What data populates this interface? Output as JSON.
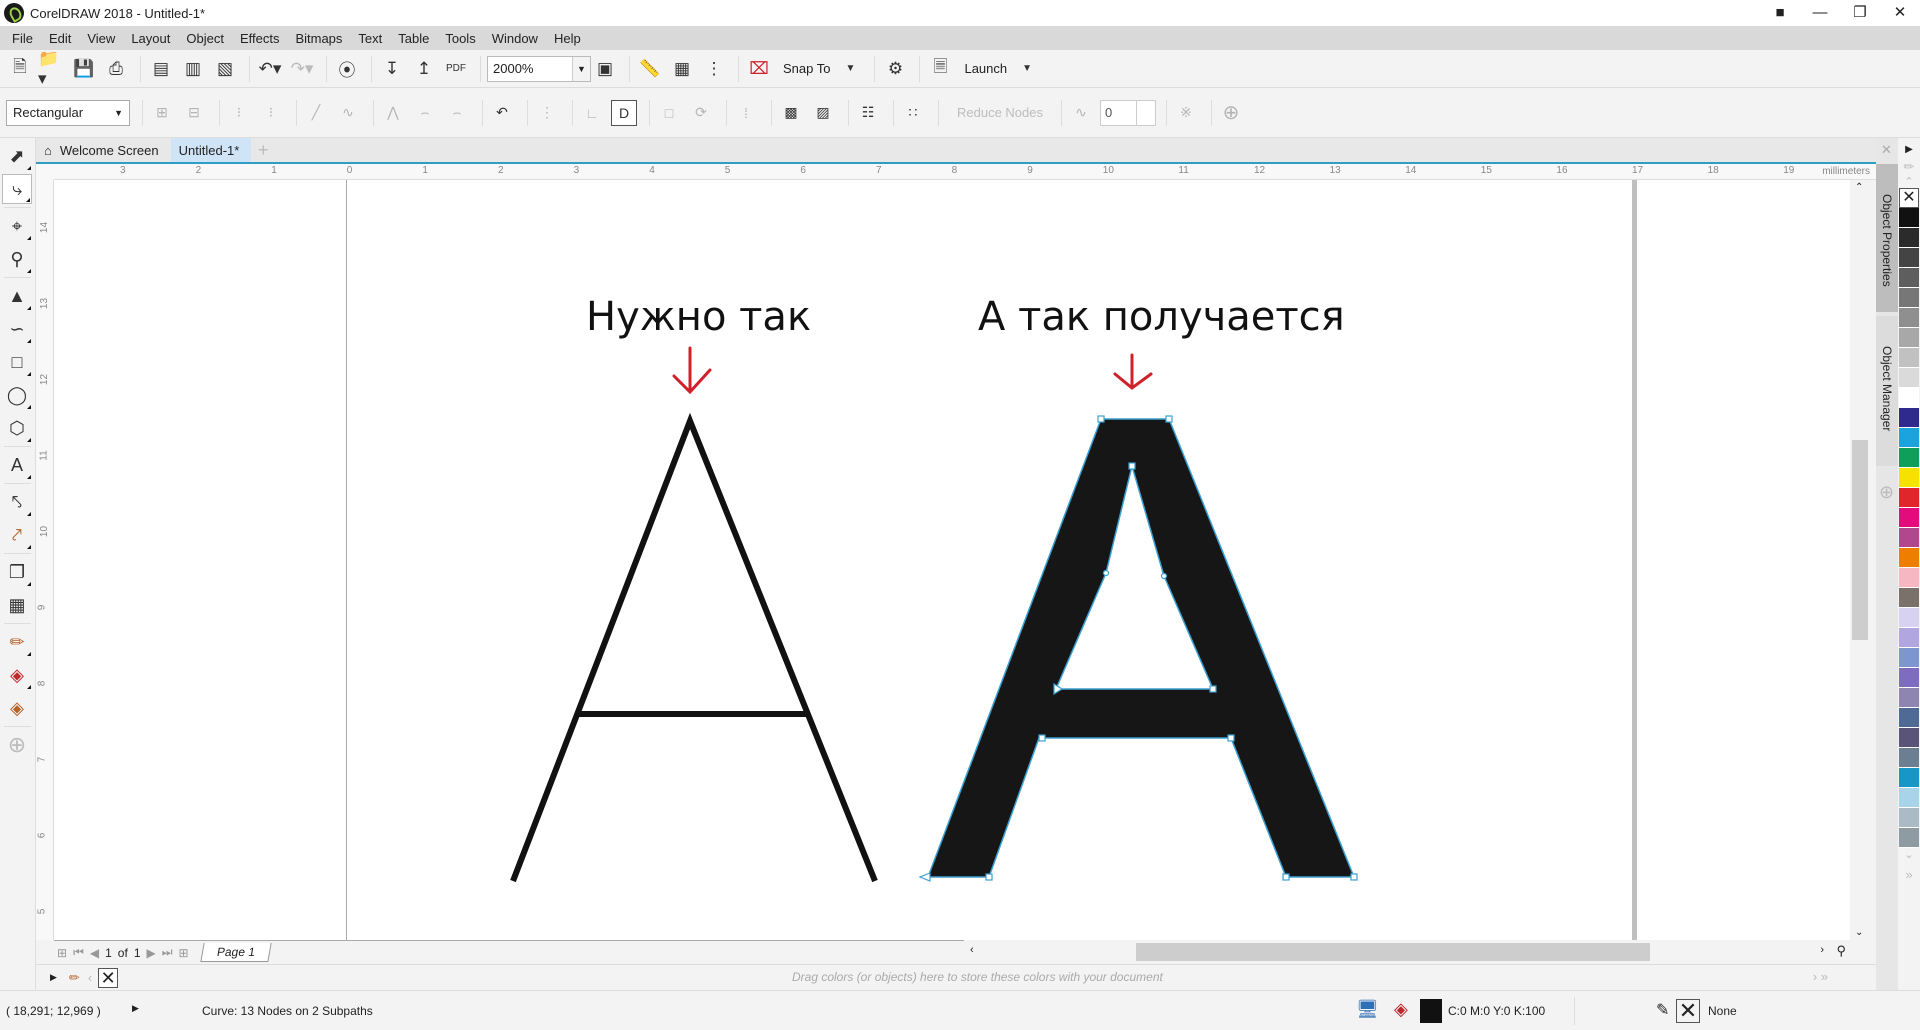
{
  "window": {
    "title": "CorelDRAW 2018 - Untitled-1*"
  },
  "menu": [
    "File",
    "Edit",
    "View",
    "Layout",
    "Object",
    "Effects",
    "Bitmaps",
    "Text",
    "Table",
    "Tools",
    "Window",
    "Help"
  ],
  "toolbar": {
    "zoom_level": "2000%",
    "snap_to_label": "Snap To",
    "launch_label": "Launch",
    "pdf_label": "PDF"
  },
  "property_bar": {
    "selection_mode": "Rectangular",
    "reduce_nodes_label": "Reduce Nodes",
    "curve_smoothness": "0"
  },
  "tabs": [
    {
      "label": "Welcome Screen"
    },
    {
      "label": "Untitled-1*"
    }
  ],
  "rulers": {
    "unit": "millimeters",
    "horizontal": [
      "3",
      "2",
      "1",
      "0",
      "1",
      "2",
      "3",
      "4",
      "5",
      "6",
      "7",
      "8",
      "9",
      "10",
      "11",
      "12",
      "13",
      "14",
      "15",
      "16",
      "17",
      "18",
      "19"
    ],
    "vertical": [
      "14",
      "13",
      "12",
      "11",
      "10",
      "9",
      "8",
      "7",
      "6",
      "5"
    ]
  },
  "canvas": {
    "label_left": "Нужно так",
    "label_right": "А так получается",
    "arrow_color": "#d0202a",
    "stroke_color": "#111111",
    "node_color": "#3aa0d0"
  },
  "page_nav": {
    "current": "1",
    "of_label": "of",
    "total": "1",
    "page_tab": "Page 1"
  },
  "doc_palette_hint": "Drag colors (or objects) here to store these colors with your document",
  "status": {
    "coordinates": "( 18,291; 12,969 )",
    "selection_info": "Curve: 13 Nodes on 2 Subpaths",
    "fill_info": "C:0 M:0 Y:0 K:100",
    "fill_color": "#111111",
    "outline_info": "None"
  },
  "dockers": [
    {
      "label": "Object Properties"
    },
    {
      "label": "Object Manager"
    }
  ],
  "color_palette": [
    "#111111",
    "#2b2b2b",
    "#444444",
    "#5e5e5e",
    "#777777",
    "#8f8f8f",
    "#a8a8a8",
    "#c1c1c1",
    "#dadada",
    "#ffffff",
    "#2e2a8e",
    "#1aa3dd",
    "#0ea05a",
    "#f6e100",
    "#e0252b",
    "#e20c7c",
    "#b2478e",
    "#ef7d00",
    "#f7b7c2",
    "#7b716b",
    "#d6d2ef",
    "#b1a6df",
    "#7e96d0",
    "#7e6cc0",
    "#8e86b0",
    "#4f6a95",
    "#5a5478",
    "#6c7e91",
    "#1796c8",
    "#a8d4ea",
    "#aabbc6",
    "#8e9ba3"
  ]
}
